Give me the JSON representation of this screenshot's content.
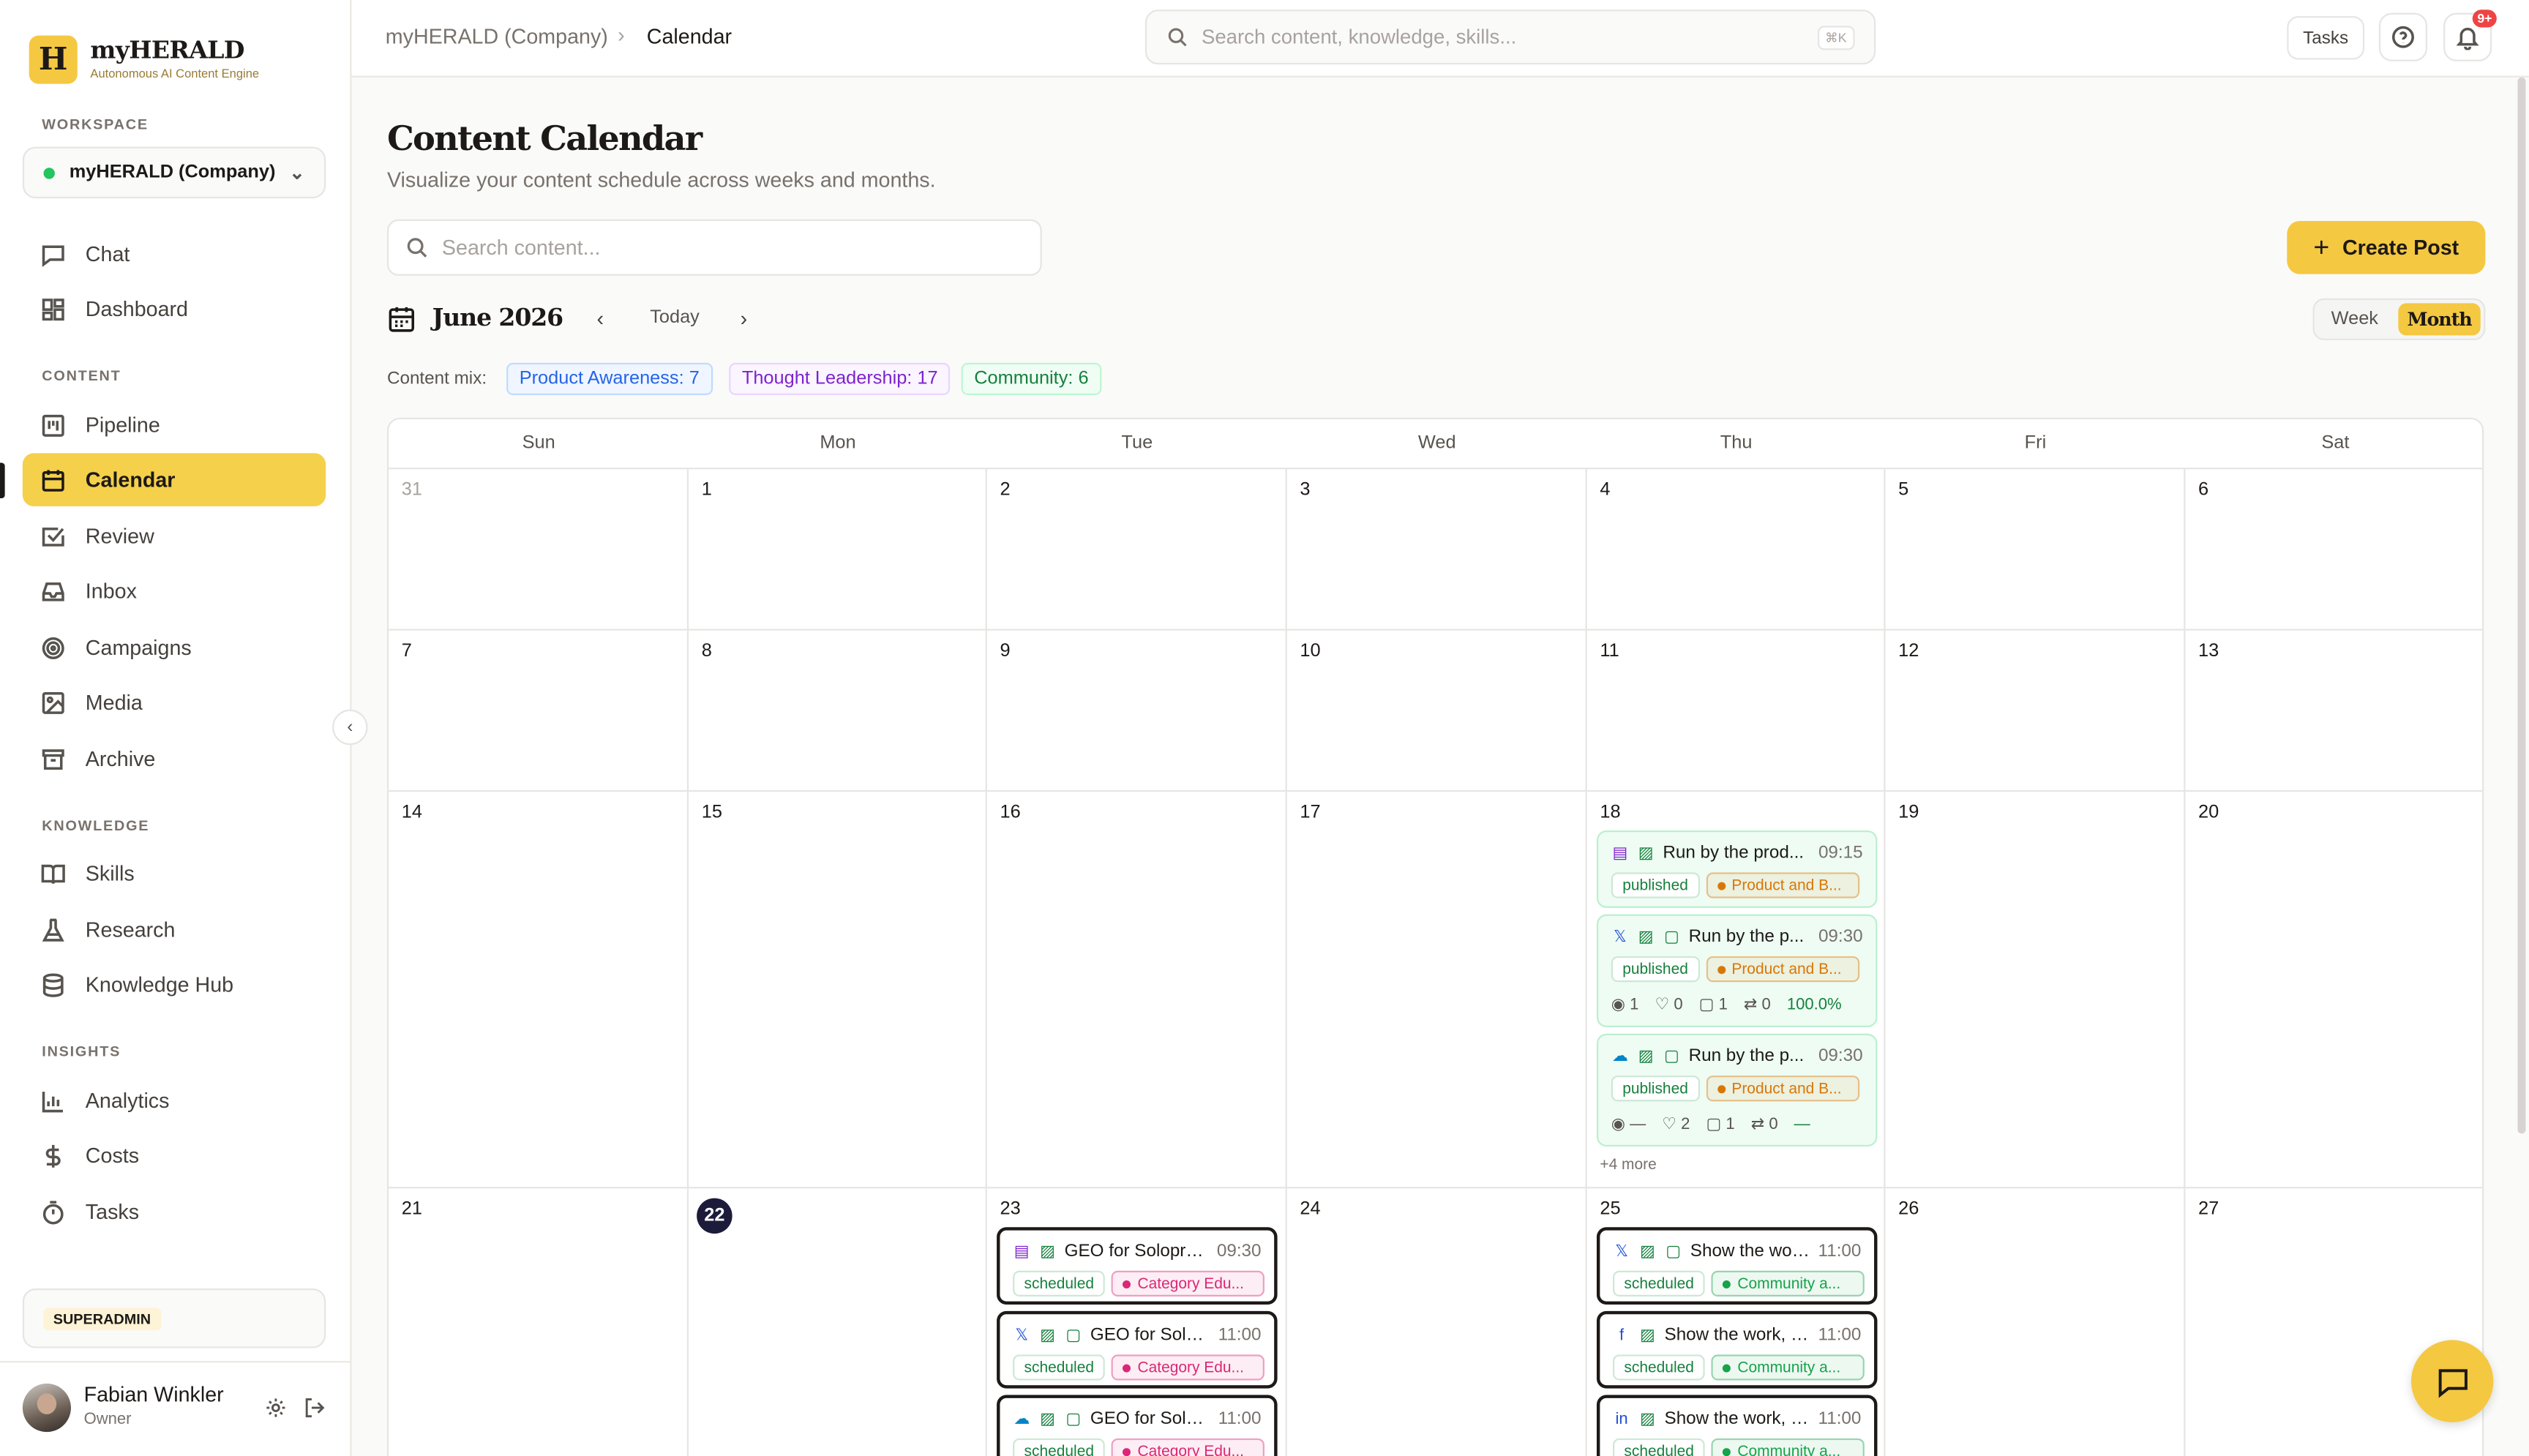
{
  "brand": {
    "name": "myHERALD",
    "tagline": "Autonomous AI Content Engine",
    "logo_letter": "H"
  },
  "sidebar": {
    "workspace_label": "WORKSPACE",
    "workspace_value": "myHERALD (Company)",
    "sections": {
      "content": "CONTENT",
      "knowledge": "KNOWLEDGE",
      "insights": "INSIGHTS"
    },
    "items": [
      {
        "label": "Chat",
        "icon": "message-square-icon"
      },
      {
        "label": "Dashboard",
        "icon": "layout-grid-icon"
      },
      {
        "label": "Pipeline",
        "icon": "kanban-icon"
      },
      {
        "label": "Calendar",
        "icon": "calendar-icon",
        "active": true
      },
      {
        "label": "Review",
        "icon": "check-square-icon"
      },
      {
        "label": "Inbox",
        "icon": "inbox-icon"
      },
      {
        "label": "Campaigns",
        "icon": "target-icon"
      },
      {
        "label": "Media",
        "icon": "image-icon"
      },
      {
        "label": "Archive",
        "icon": "archive-icon"
      },
      {
        "label": "Skills",
        "icon": "book-open-icon"
      },
      {
        "label": "Research",
        "icon": "flask-icon"
      },
      {
        "label": "Knowledge Hub",
        "icon": "database-icon"
      },
      {
        "label": "Analytics",
        "icon": "bar-chart-icon"
      },
      {
        "label": "Costs",
        "icon": "dollar-icon"
      },
      {
        "label": "Tasks",
        "icon": "timer-icon"
      }
    ],
    "role_badge": "SUPERADMIN",
    "user": {
      "name": "Fabian Winkler",
      "role": "Owner"
    }
  },
  "topbar": {
    "breadcrumb": [
      "myHERALD (Company)",
      "Calendar"
    ],
    "search_placeholder": "Search content, knowledge, skills...",
    "search_shortcut": "⌘K",
    "tasks_label": "Tasks",
    "notification_count": "9+"
  },
  "page": {
    "title": "Content Calendar",
    "subtitle": "Visualize your content schedule across weeks and months.",
    "search_placeholder": "Search content...",
    "create_label": "Create Post",
    "month_label": "June 2026",
    "today_label": "Today",
    "view_toggle": {
      "week": "Week",
      "month": "Month",
      "selected": "Month"
    },
    "content_mix_label": "Content mix:",
    "content_mix": [
      {
        "label": "Product Awareness: 7",
        "color": "#2563eb",
        "bg": "#eff6ff",
        "border": "#bfdbfe"
      },
      {
        "label": "Thought Leadership: 17",
        "color": "#7e22ce",
        "bg": "#faf5ff",
        "border": "#e9d5ff"
      },
      {
        "label": "Community: 6",
        "color": "#15803d",
        "bg": "#f0fdf4",
        "border": "#bbf7d0"
      }
    ]
  },
  "calendar": {
    "weekdays": [
      "Sun",
      "Mon",
      "Tue",
      "Wed",
      "Thu",
      "Fri",
      "Sat"
    ],
    "weeks": [
      [
        "31",
        "1",
        "2",
        "3",
        "4",
        "5",
        "6"
      ],
      [
        "7",
        "8",
        "9",
        "10",
        "11",
        "12",
        "13"
      ],
      [
        "14",
        "15",
        "16",
        "17",
        "18",
        "19",
        "20"
      ],
      [
        "21",
        "22",
        "23",
        "24",
        "25",
        "26",
        "27"
      ]
    ],
    "today": "22",
    "outside_month": [
      "31"
    ],
    "posts": {
      "18": {
        "items": [
          {
            "title": "Run by the prod...",
            "time": "09:15",
            "status": "published",
            "category": "Product and B...",
            "icons": [
              "document-icon",
              "image-icon"
            ]
          },
          {
            "title": "Run by the p...",
            "time": "09:30",
            "status": "published",
            "category": "Product and B...",
            "icons": [
              "x-logo-icon",
              "image-icon",
              "comment-icon"
            ],
            "stats": [
              "1",
              "0",
              "1",
              "0",
              "100.0%"
            ]
          },
          {
            "title": "Run by the p...",
            "time": "09:30",
            "status": "published",
            "category": "Product and B...",
            "icons": [
              "bluesky-icon",
              "image-icon",
              "comment-icon"
            ],
            "stats": [
              "—",
              "2",
              "1",
              "0",
              "—"
            ]
          }
        ],
        "more": "+4 more"
      },
      "23": {
        "items": [
          {
            "title": "GEO for Solopre...",
            "time": "09:30",
            "status": "scheduled",
            "category": "Category Edu...",
            "icons": [
              "document-icon",
              "image-icon"
            ]
          },
          {
            "title": "GEO for Solop...",
            "time": "11:00",
            "status": "scheduled",
            "category": "Category Edu...",
            "icons": [
              "x-logo-icon",
              "image-icon",
              "comment-icon"
            ]
          },
          {
            "title": "GEO for Solop...",
            "time": "11:00",
            "status": "scheduled",
            "category": "Category Edu...",
            "icons": [
              "bluesky-icon",
              "image-icon",
              "comment-icon"
            ]
          }
        ]
      },
      "25": {
        "items": [
          {
            "title": "Show the wor...",
            "time": "11:00",
            "status": "scheduled",
            "category": "Community a...",
            "icons": [
              "x-logo-icon",
              "image-icon",
              "comment-icon"
            ]
          },
          {
            "title": "Show the work, d...",
            "time": "11:00",
            "status": "scheduled",
            "category": "Community a...",
            "icons": [
              "facebook-icon",
              "image-icon"
            ]
          },
          {
            "title": "Show the work, d...",
            "time": "11:00",
            "status": "scheduled",
            "category": "Community a...",
            "icons": [
              "linkedin-icon",
              "image-icon"
            ]
          }
        ]
      }
    },
    "category_colors": {
      "Product and B...": "#d97706",
      "Category Edu...": "#db2777",
      "Community a...": "#16a34a"
    }
  }
}
